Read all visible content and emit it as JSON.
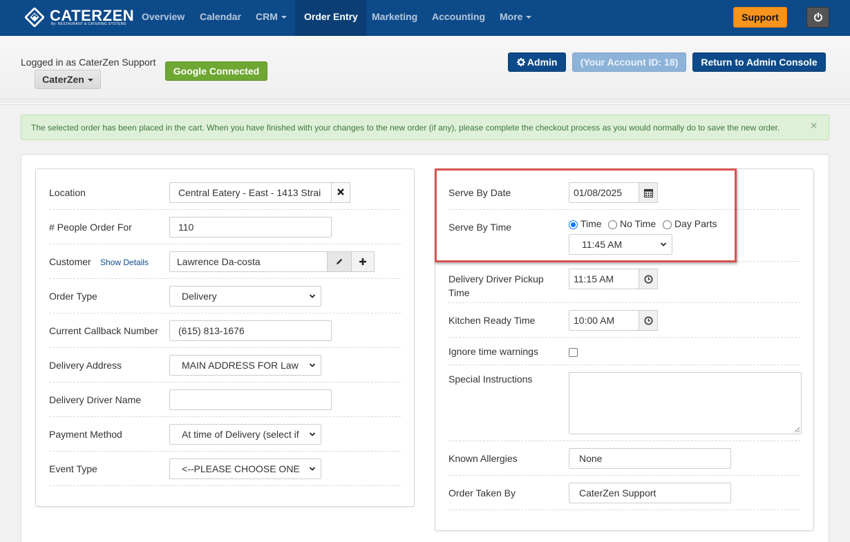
{
  "brand": {
    "name": "CaterZen",
    "logo_text": "CATERZEN",
    "tagline": "By: RESTAURANT & CATERING SYSTEMS"
  },
  "nav": {
    "items": [
      {
        "label": "Overview"
      },
      {
        "label": "Calendar"
      },
      {
        "label": "CRM"
      },
      {
        "label": "Order Entry"
      },
      {
        "label": "Marketing"
      },
      {
        "label": "Accounting"
      },
      {
        "label": "More"
      }
    ],
    "active": "Order Entry",
    "support_label": "Support"
  },
  "header": {
    "logged_in_text": "Logged in as CaterZen Support",
    "account_menu_label": "CaterZen",
    "google_label": "Google Connected",
    "admin_label": "Admin",
    "account_id_label": "(Your Account ID: 18)",
    "return_label": "Return to Admin Console"
  },
  "alert": {
    "message": "The selected order has been placed in the cart. When you have finished with your changes to the new order (if any), please complete the checkout process as you would normally do to save the new order.",
    "close_symbol": "×"
  },
  "left_form": {
    "location_label": "Location",
    "location_value": "Central Eatery - East - 1413 Strai",
    "people_label": "# People Order For",
    "people_value": "110",
    "customer_label": "Customer",
    "show_details_label": "Show Details",
    "customer_value": "Lawrence Da-costa",
    "order_type_label": "Order Type",
    "order_type_value": "Delivery",
    "callback_label": "Current Callback Number",
    "callback_value": "(615) 813-1676",
    "delivery_address_label": "Delivery Address",
    "delivery_address_value": "MAIN ADDRESS FOR Law",
    "driver_name_label": "Delivery Driver Name",
    "driver_name_value": "",
    "payment_label": "Payment Method",
    "payment_value": "At time of Delivery (select if",
    "event_type_label": "Event Type",
    "event_type_value": "<--PLEASE CHOOSE ONE"
  },
  "right_form": {
    "serve_date_label": "Serve By Date",
    "serve_date_value": "01/08/2025",
    "serve_time_label": "Serve By Time",
    "time_options": [
      "Time",
      "No Time",
      "Day Parts"
    ],
    "time_selected": "Time",
    "serve_time_value": "11:45 AM",
    "pickup_label_line1": "Delivery Driver Pickup",
    "pickup_label_line2": "Time",
    "pickup_value": "11:15 AM",
    "kitchen_label": "Kitchen Ready Time",
    "kitchen_value": "10:00 AM",
    "ignore_label": "Ignore time warnings",
    "ignore_checked": false,
    "special_label": "Special Instructions",
    "special_value": "",
    "allergies_label": "Known Allergies",
    "allergies_value": "None",
    "taken_by_label": "Order Taken By",
    "taken_by_value": "CaterZen Support"
  },
  "colors": {
    "navbar": "#0d4a8a",
    "support": "#f7941d",
    "google": "#6ea732",
    "alert_bg": "#dff0d8",
    "highlight": "#d9534f"
  }
}
